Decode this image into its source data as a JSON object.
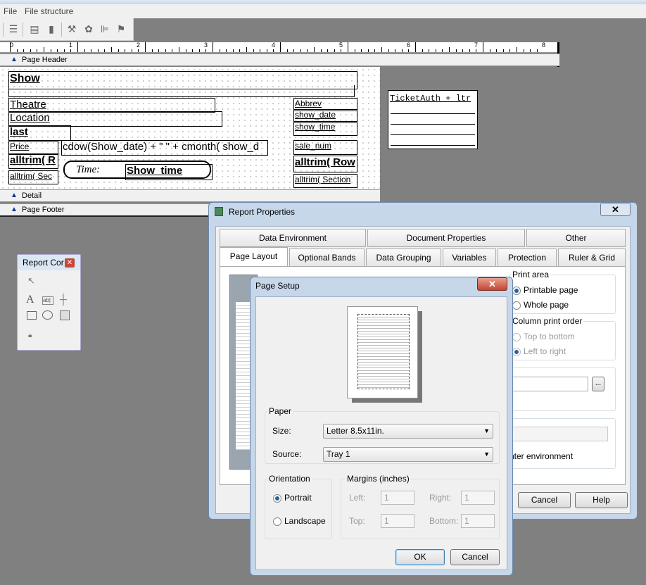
{
  "menu": {
    "file": "File",
    "file_structure": "File structure"
  },
  "ruler": {
    "numbers": [
      "0",
      "1",
      "2",
      "3",
      "4",
      "5",
      "6",
      "7",
      "8"
    ]
  },
  "bands": {
    "page_header": "Page Header",
    "detail": "Detail",
    "page_footer": "Page Footer"
  },
  "header_fields": {
    "show": "Show",
    "theatre": "Theatre",
    "location": "Location",
    "last": "last",
    "price": "Price",
    "cdow": "cdow(Show_date) + \" \" + cmonth( show_d",
    "alltrim_r": "alltrim( R",
    "alltrim_sec": "alltrim( Sec",
    "time_label": "Time:",
    "show_time_big": "Show_time",
    "abbrev": "Abbrev",
    "show_date": "show_date",
    "show_time": "show_time",
    "sale_num": "sale_num",
    "alltrim_row": "alltrim( Row",
    "alltrim_section": "alltrim( Section",
    "ticketauth": "TicketAuth + ltr"
  },
  "report_controls": {
    "title": "Report Cor"
  },
  "report_properties": {
    "title": "Report Properties",
    "tabs_back": [
      "Data Environment",
      "Document Properties",
      "Other"
    ],
    "tabs_front": [
      "Page Layout",
      "Optional Bands",
      "Data Grouping",
      "Variables",
      "Protection",
      "Ruler & Grid"
    ],
    "print_area": {
      "label": "Print area",
      "printable": "Printable page",
      "whole": "Whole page",
      "selected": "printable"
    },
    "column_order": {
      "label": "Column print order",
      "top_bottom": "Top to bottom",
      "left_right": "Left to right",
      "selected": "left_right"
    },
    "ellipsis": "...",
    "env_text": "nter environment",
    "cancel": "Cancel",
    "help": "Help"
  },
  "page_setup": {
    "title": "Page Setup",
    "paper_label": "Paper",
    "size_label": "Size:",
    "size_value": "Letter 8.5x11in.",
    "source_label": "Source:",
    "source_value": "Tray 1",
    "orientation_label": "Orientation",
    "portrait": "Portrait",
    "landscape": "Landscape",
    "orientation_selected": "portrait",
    "margins_label": "Margins (inches)",
    "left_label": "Left:",
    "left_value": "1",
    "right_label": "Right:",
    "right_value": "1",
    "top_label": "Top:",
    "top_value": "1",
    "bottom_label": "Bottom:",
    "bottom_value": "1",
    "ok": "OK",
    "cancel": "Cancel"
  }
}
